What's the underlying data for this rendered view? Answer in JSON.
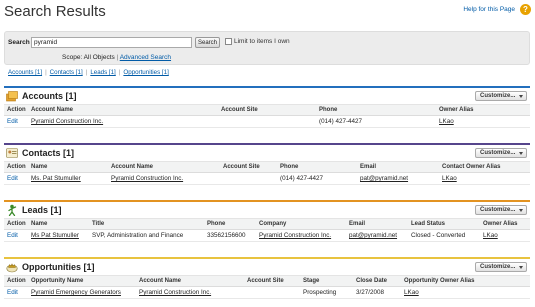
{
  "header": {
    "title": "Search Results",
    "help_label": "Help for this Page",
    "help_icon": "?"
  },
  "search": {
    "label": "Search",
    "value": "pyramid",
    "button": "Search",
    "limit_label": "Limit to items I own",
    "scope_label": "Scope: All Objects",
    "scope_sep": "|",
    "advanced_label": "Advanced Search"
  },
  "jumplinks": [
    "Accounts [1]",
    "Contacts [1]",
    "Leads [1]",
    "Opportunities [1]"
  ],
  "sections": {
    "accounts": {
      "title": "Accounts [1]",
      "customize": "Customize...",
      "color": "#236fbd",
      "columns": [
        "Action",
        "Account Name",
        "Account Site",
        "Phone",
        "Owner Alias"
      ],
      "rows": [
        [
          "Edit",
          "Pyramid Construction Inc.",
          "",
          "(014) 427-4427",
          "LKao"
        ]
      ]
    },
    "contacts": {
      "title": "Contacts [1]",
      "customize": "Customize...",
      "color": "#56458c",
      "columns": [
        "Action",
        "Name",
        "Account Name",
        "Account Site",
        "Phone",
        "Email",
        "Contact Owner Alias"
      ],
      "rows": [
        [
          "Edit",
          "Ms. Pat Stumuller",
          "Pyramid Construction Inc.",
          "",
          "(014) 427-4427",
          "pat@pyramid.net",
          "LKao"
        ]
      ]
    },
    "leads": {
      "title": "Leads [1]",
      "customize": "Customize...",
      "color": "#e39321",
      "columns": [
        "Action",
        "Name",
        "Title",
        "Phone",
        "Company",
        "Email",
        "Lead Status",
        "Owner Alias"
      ],
      "rows": [
        [
          "Edit",
          "Ms Pat Stumuller",
          "SVP, Administration and Finance",
          "33562156600",
          "Pyramid Construction Inc.",
          "pat@pyramid.net",
          "Closed - Converted",
          "LKao"
        ]
      ]
    },
    "opportunities": {
      "title": "Opportunities [1]",
      "customize": "Customize...",
      "color": "#e8c33f",
      "columns": [
        "Action",
        "Opportunity Name",
        "Account Name",
        "Account Site",
        "Stage",
        "Close Date",
        "Opportunity Owner Alias"
      ],
      "rows": [
        [
          "Edit",
          "Pyramid Emergency Generators",
          "Pyramid Construction Inc.",
          "",
          "Prospecting",
          "3/27/2008",
          "LKao"
        ]
      ]
    }
  }
}
